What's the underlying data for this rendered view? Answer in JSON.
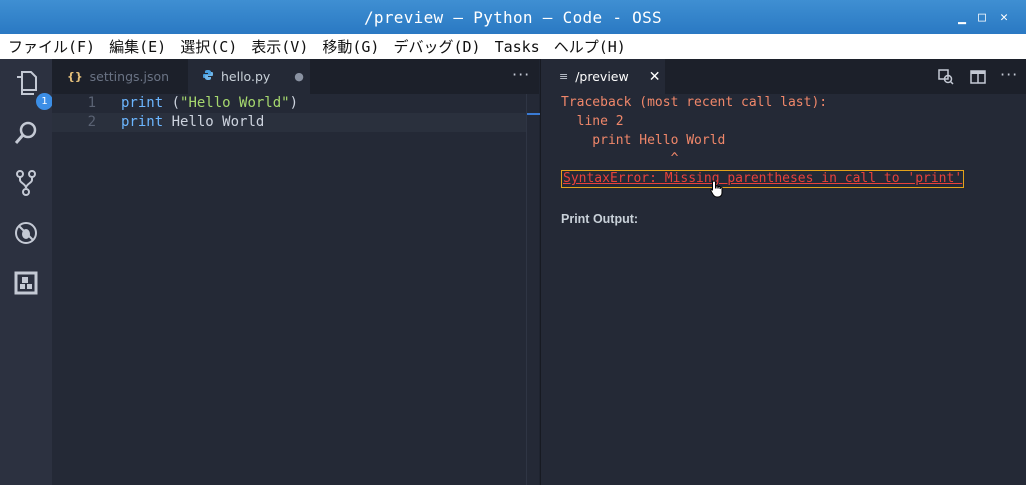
{
  "window": {
    "title": "/preview — Python — Code - OSS",
    "minimize": "▁",
    "maximize": "□",
    "close": "✕"
  },
  "menu": [
    "ファイル(F)",
    "編集(E)",
    "選択(C)",
    "表示(V)",
    "移動(G)",
    "デバッグ(D)",
    "Tasks",
    "ヘルプ(H)"
  ],
  "activity_bar": {
    "explorer_badge": "1",
    "icons": [
      "files-icon",
      "search-icon",
      "source-control-icon",
      "debug-icon",
      "extensions-icon"
    ]
  },
  "editor": {
    "tabs": [
      {
        "label": "settings.json",
        "icon": "{}",
        "active": false
      },
      {
        "label": "hello.py",
        "icon": "python-icon",
        "active": true,
        "modified_dot": "●"
      }
    ],
    "more": "···",
    "lines": [
      {
        "number": "1",
        "keyword": "print",
        "rest_pre": " (",
        "string": "\"Hello World\"",
        "rest_post": ")"
      },
      {
        "number": "2",
        "keyword": "print",
        "rest_pre": " Hello World",
        "string": "",
        "rest_post": ""
      }
    ]
  },
  "preview": {
    "tab_label": "/preview",
    "tab_icon": "≡",
    "tab_close": "✕",
    "more": "···",
    "output": {
      "line1": "Traceback (most recent call last):",
      "line2": "  line 2",
      "line3": "    print Hello World",
      "line4": "              ^",
      "error": "SyntaxError: Missing parentheses in call to 'print'"
    },
    "print_output_label": "Print Output:"
  },
  "colors": {
    "titlebar": "#2a79c3",
    "editor_bg": "#242936",
    "error_text": "#e8413b",
    "error_border": "#e3a21a",
    "traceback_text": "#f0876a"
  }
}
